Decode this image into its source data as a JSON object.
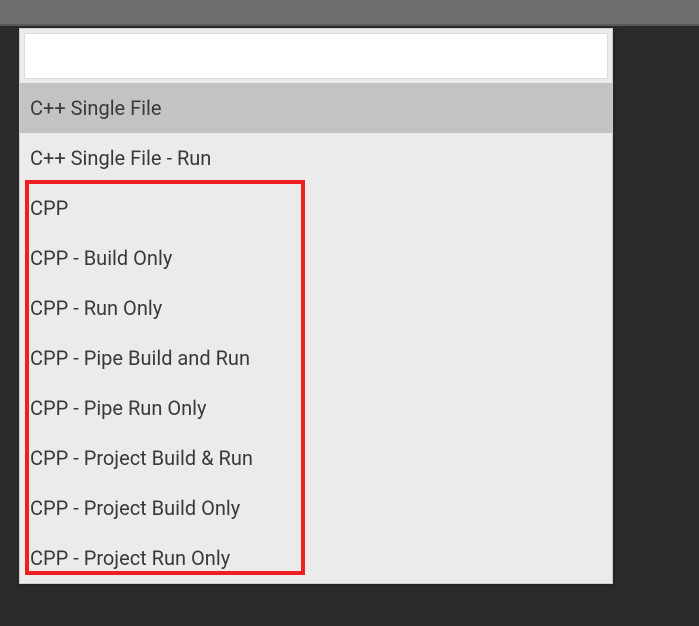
{
  "search": {
    "value": "",
    "placeholder": ""
  },
  "items": [
    {
      "label": "C++ Single File",
      "selected": true
    },
    {
      "label": "C++ Single File - Run",
      "selected": false
    },
    {
      "label": "CPP",
      "selected": false
    },
    {
      "label": "CPP - Build Only",
      "selected": false
    },
    {
      "label": "CPP - Run Only",
      "selected": false
    },
    {
      "label": "CPP - Pipe Build and Run",
      "selected": false
    },
    {
      "label": "CPP - Pipe Run Only",
      "selected": false
    },
    {
      "label": "CPP - Project Build & Run",
      "selected": false
    },
    {
      "label": "CPP - Project Build Only",
      "selected": false
    },
    {
      "label": "CPP - Project Run Only",
      "selected": false
    }
  ]
}
